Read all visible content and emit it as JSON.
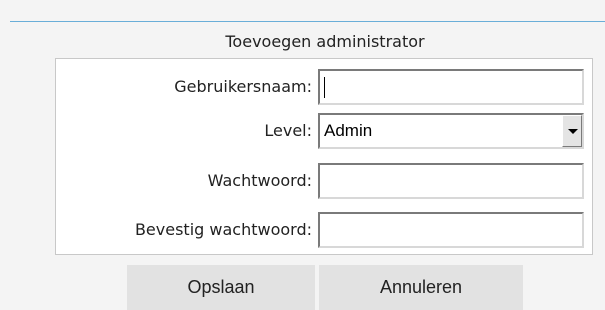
{
  "form": {
    "title": "Toevoegen administrator",
    "fields": {
      "username": {
        "label": "Gebruikersnaam:",
        "value": ""
      },
      "level": {
        "label": "Level:",
        "selected": "Admin"
      },
      "password": {
        "label": "Wachtwoord:",
        "value": ""
      },
      "confirm_password": {
        "label": "Bevestig wachtwoord:",
        "value": ""
      }
    },
    "buttons": {
      "save": "Opslaan",
      "cancel": "Annuleren"
    }
  },
  "colors": {
    "accent_line": "#6aaed8",
    "button_bg": "#e2e2e2",
    "panel_bg": "#ffffff"
  },
  "icons": {
    "select_arrow": "chevron-down-icon"
  }
}
